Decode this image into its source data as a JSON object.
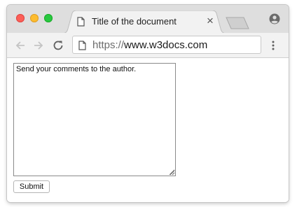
{
  "browser": {
    "tab": {
      "title": "Title of the document",
      "close_glyph": "×"
    },
    "address_bar": {
      "scheme": "https://",
      "host": "www.w3docs.com"
    },
    "icons": [
      "back-arrow-icon",
      "forward-arrow-icon",
      "reload-icon",
      "page-icon",
      "document-icon",
      "close-icon",
      "new-tab-icon",
      "profile-icon",
      "menu-icon"
    ],
    "colors": {
      "close": "#fc5f57",
      "minimize": "#fdbc2e",
      "zoom": "#28c840",
      "tabbar": "#dedede",
      "toolbar": "#f2f2f2"
    }
  },
  "page": {
    "textarea": {
      "value": "Send your comments to the author."
    },
    "submit_label": "Submit"
  }
}
